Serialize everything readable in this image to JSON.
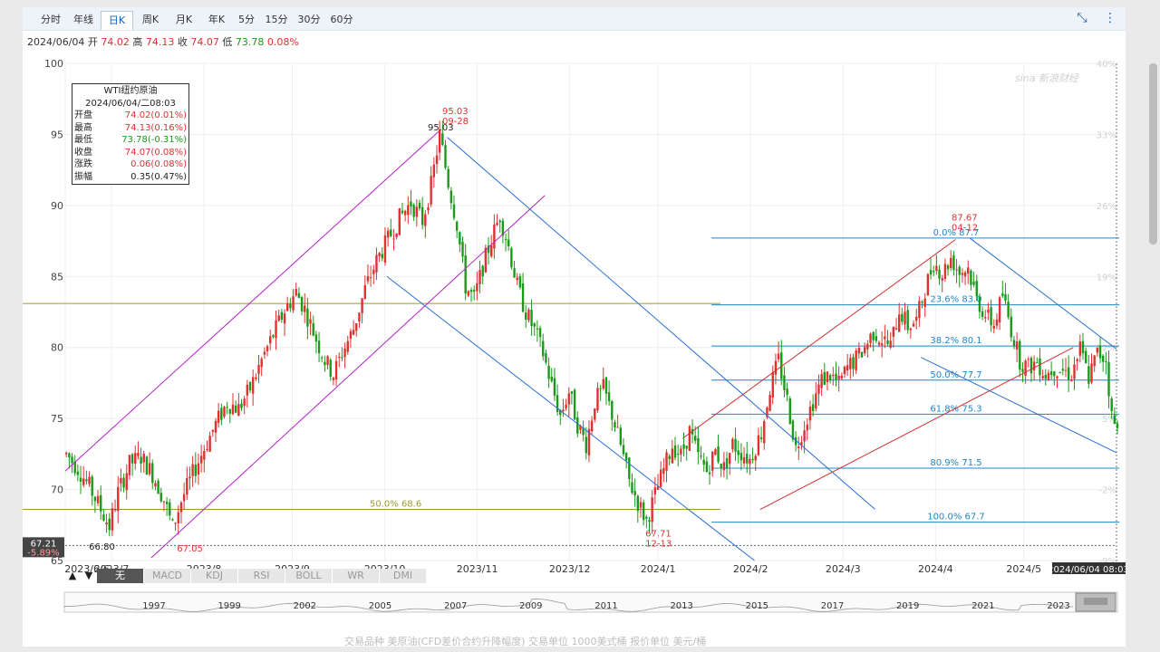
{
  "tabs": [
    "分时",
    "年线",
    "日K",
    "周K",
    "月K",
    "年K",
    "5分",
    "15分",
    "30分",
    "60分"
  ],
  "active_tab": "日K",
  "info": {
    "date": "2024/06/04",
    "open_label": "开",
    "open": "74.02",
    "high_label": "高",
    "high": "74.13",
    "close_label": "收",
    "close": "74.07",
    "low_label": "低",
    "low": "73.78",
    "change_pct": "0.08%"
  },
  "ohlc_box": {
    "title": "WTI纽约原油",
    "datetime": "2024/06/04/二08:03",
    "rows": [
      {
        "label": "开盘",
        "value": "74.02(0.01%)",
        "tone": "up"
      },
      {
        "label": "最高",
        "value": "74.13(0.16%)",
        "tone": "up"
      },
      {
        "label": "最低",
        "value": "73.78(-0.31%)",
        "tone": "dn"
      },
      {
        "label": "收盘",
        "value": "74.07(0.08%)",
        "tone": "up"
      },
      {
        "label": "涨跌",
        "value": "0.06(0.08%)",
        "tone": "up"
      },
      {
        "label": "振幅",
        "value": "0.35(0.47%)",
        "tone": "plain"
      }
    ]
  },
  "colors": {
    "up": "#e03030",
    "down": "#1a9a1a",
    "fib": "#1f86c8",
    "channel_purple": "#b520c8",
    "channel_blue": "#2a70d0",
    "channel_red": "#d03030",
    "olive": "#9a9a30"
  },
  "chart_data": {
    "type": "candlestick",
    "ylim": [
      65,
      100
    ],
    "y_ticks": [
      100,
      95,
      90,
      85,
      80,
      75,
      70,
      65
    ],
    "right_ticks": [
      "40%",
      "33%",
      "26%",
      "19%",
      "12%",
      "5%",
      "-2%",
      "-9%"
    ],
    "x_tick_labels": [
      "2023/6/6",
      "2023/7",
      "2023/8",
      "2023/9",
      "2023/10",
      "2023/11",
      "2023/12",
      "2024/1",
      "2024/2",
      "2024/3",
      "2024/4",
      "2024/5"
    ],
    "last_x_label": "2024/06/04 08:03",
    "price_marker": {
      "value": "67.21",
      "pct": "-5.89%"
    },
    "annotations": [
      {
        "text": "95.03",
        "value": 95.03
      },
      {
        "text": "95.03",
        "sub": "09-28",
        "value": 95.03
      },
      {
        "text": "66.80",
        "value": 66.8
      },
      {
        "text": "67.05",
        "value": 67.05
      },
      {
        "text": "67.71",
        "sub": "12-13",
        "value": 67.71
      },
      {
        "text": "87.67",
        "sub": "04-12",
        "value": 87.67
      }
    ],
    "fib_levels": [
      {
        "label": "0.0% 87.7",
        "value": 87.7
      },
      {
        "label": "23.6% 83.0",
        "value": 83.0
      },
      {
        "label": "38.2% 80.1",
        "value": 80.1
      },
      {
        "label": "50.0% 77.7",
        "value": 77.7
      },
      {
        "label": "61.8% 75.3",
        "value": 75.3
      },
      {
        "label": "80.9% 71.5",
        "value": 71.5
      },
      {
        "label": "100.0% 67.7",
        "value": 67.7
      }
    ],
    "olive_levels": [
      {
        "label": "",
        "value": 83.1
      },
      {
        "label": "50.0% 68.6",
        "value": 68.6
      }
    ],
    "trend_points": [
      [
        0,
        72.5
      ],
      [
        4,
        71.5
      ],
      [
        8,
        70.2
      ],
      [
        12,
        68.6
      ],
      [
        15,
        67.4
      ],
      [
        18,
        69.8
      ],
      [
        22,
        71.8
      ],
      [
        26,
        72.3
      ],
      [
        30,
        71.1
      ],
      [
        34,
        69.3
      ],
      [
        37,
        67.3
      ],
      [
        40,
        69.2
      ],
      [
        44,
        71.1
      ],
      [
        48,
        72.9
      ],
      [
        52,
        74.6
      ],
      [
        56,
        76.1
      ],
      [
        60,
        75.7
      ],
      [
        64,
        77.1
      ],
      [
        68,
        79.1
      ],
      [
        72,
        80.9
      ],
      [
        76,
        82.6
      ],
      [
        80,
        83.9
      ],
      [
        83,
        82.7
      ],
      [
        86,
        81.1
      ],
      [
        90,
        79.1
      ],
      [
        93,
        78.1
      ],
      [
        96,
        79.6
      ],
      [
        100,
        81.3
      ],
      [
        104,
        84.1
      ],
      [
        108,
        86.1
      ],
      [
        112,
        87.6
      ],
      [
        116,
        89.1
      ],
      [
        120,
        90.2
      ],
      [
        124,
        88.9
      ],
      [
        127,
        91.4
      ],
      [
        130,
        95.0
      ],
      [
        133,
        91.6
      ],
      [
        136,
        88.7
      ],
      [
        139,
        84.3
      ],
      [
        142,
        83.4
      ],
      [
        145,
        85.7
      ],
      [
        148,
        87.6
      ],
      [
        151,
        89.3
      ],
      [
        154,
        87.1
      ],
      [
        157,
        84.3
      ],
      [
        160,
        82.5
      ],
      [
        163,
        81.2
      ],
      [
        166,
        79.6
      ],
      [
        169,
        77.3
      ],
      [
        172,
        75.2
      ],
      [
        175,
        76.9
      ],
      [
        178,
        74.6
      ],
      [
        181,
        73.2
      ],
      [
        184,
        76.2
      ],
      [
        187,
        77.1
      ],
      [
        190,
        75.3
      ],
      [
        193,
        73.1
      ],
      [
        196,
        70.6
      ],
      [
        199,
        69.1
      ],
      [
        202,
        67.8
      ],
      [
        205,
        69.6
      ],
      [
        208,
        71.4
      ],
      [
        211,
        73.1
      ],
      [
        214,
        72.4
      ],
      [
        217,
        74.1
      ],
      [
        220,
        72.3
      ],
      [
        223,
        71.3
      ],
      [
        226,
        72.7
      ],
      [
        229,
        71.5
      ],
      [
        232,
        73.2
      ],
      [
        235,
        72.6
      ],
      [
        238,
        72.1
      ],
      [
        242,
        74.0
      ],
      [
        245,
        77.1
      ],
      [
        248,
        79.1
      ],
      [
        251,
        76.3
      ],
      [
        254,
        72.9
      ],
      [
        257,
        74.6
      ],
      [
        260,
        76.2
      ],
      [
        263,
        77.7
      ],
      [
        266,
        78.1
      ],
      [
        269,
        77.4
      ],
      [
        272,
        78.6
      ],
      [
        275,
        79.2
      ],
      [
        278,
        80.0
      ],
      [
        281,
        81.1
      ],
      [
        284,
        80.6
      ],
      [
        287,
        80.1
      ],
      [
        290,
        82.7
      ],
      [
        293,
        81.5
      ],
      [
        296,
        81.9
      ],
      [
        299,
        84.1
      ],
      [
        302,
        86.0
      ],
      [
        305,
        85.2
      ],
      [
        308,
        86.3
      ],
      [
        311,
        85.3
      ],
      [
        314,
        85.6
      ],
      [
        317,
        83.4
      ],
      [
        320,
        82.3
      ],
      [
        323,
        81.6
      ],
      [
        326,
        83.7
      ],
      [
        329,
        81.3
      ],
      [
        332,
        79.1
      ],
      [
        335,
        78.6
      ],
      [
        338,
        79.0
      ],
      [
        341,
        78.1
      ],
      [
        344,
        78.6
      ],
      [
        347,
        78.4
      ],
      [
        350,
        78.1
      ],
      [
        353,
        79.9
      ],
      [
        356,
        77.9
      ],
      [
        359,
        79.6
      ],
      [
        362,
        79.2
      ],
      [
        364,
        75.1
      ],
      [
        366,
        74.07
      ]
    ]
  },
  "indicator_tabs": [
    "无",
    "MACD",
    "KDJ",
    "RSI",
    "BOLL",
    "WR",
    "DMI"
  ],
  "indicator_selected": "无",
  "navigator_years": [
    "1997",
    "1999",
    "2002",
    "2005",
    "2007",
    "2009",
    "2011",
    "2013",
    "2015",
    "2017",
    "2019",
    "2021",
    "2023"
  ],
  "watermark": "sina 新浪财经",
  "bottom_text": "交易品种     美原油(CFD差价合约升降幅度)     交易单位     1000美式桶     报价单位     美元/桶"
}
